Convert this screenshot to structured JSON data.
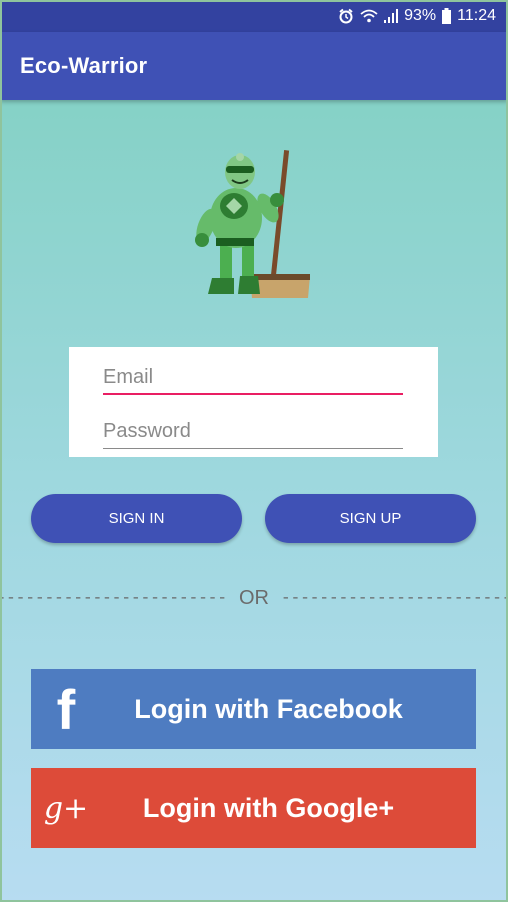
{
  "status_bar": {
    "battery": "93%",
    "time": "11:24",
    "icons": [
      "alarm-icon",
      "wifi-icon",
      "signal-icon",
      "battery-icon"
    ]
  },
  "app_bar": {
    "title": "Eco-Warrior"
  },
  "mascot": {
    "icon": "eco-warrior-mascot-icon"
  },
  "form": {
    "email_placeholder": "Email",
    "email_value": "",
    "password_placeholder": "Password",
    "password_value": ""
  },
  "buttons": {
    "sign_in": "SIGN IN",
    "sign_up": "SIGN UP"
  },
  "divider": {
    "left_dashes": "------------------------",
    "label": "OR",
    "right_dashes": "------------------------"
  },
  "social": {
    "facebook_label": "Login with Facebook",
    "facebook_icon": "f",
    "google_label": "Login with Google+",
    "google_icon": "g+"
  },
  "colors": {
    "primary": "#3f51b5",
    "status_bar": "#3342a0",
    "accent": "#e91e63",
    "facebook": "#4e7cc1",
    "google": "#dd4b39"
  }
}
